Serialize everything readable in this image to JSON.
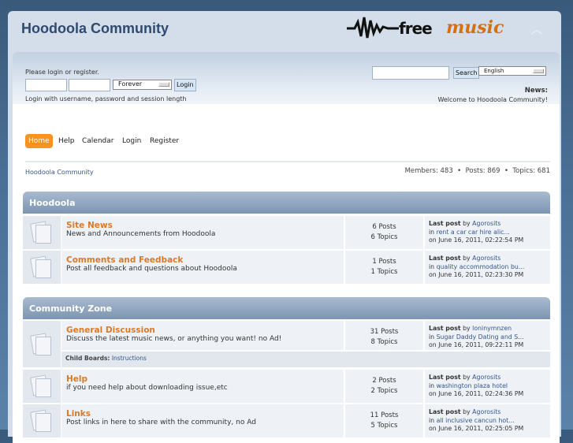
{
  "header": {
    "title": "Hoodoola Community",
    "logo_text_1": "free",
    "logo_text_2": "music",
    "collapse_icon": "chevron-up-icon"
  },
  "login": {
    "prompt": "Please login or register.",
    "session_value": "Forever",
    "login_button": "Login",
    "hint": "Login with username, password and session length"
  },
  "search": {
    "button": "Search",
    "language": "English"
  },
  "news": {
    "label": "News:",
    "text": "Welcome to Hoodoola Community!",
    "text2": "!"
  },
  "nav": [
    "Home",
    "Help",
    "Calendar",
    "Login",
    "Register"
  ],
  "breadcrumb": "Hoodoola Community",
  "stats": "Members: 483  •  Posts: 869  •  Topics: 681",
  "accent": "#f7931e",
  "categories": [
    {
      "name": "Hoodoola",
      "boards": [
        {
          "name": "Site News",
          "desc": "News and Announcements from Hoodoola",
          "posts": "6 Posts",
          "topics": "6 Topics",
          "last_by": "Agorosits",
          "last_in": "rent a car car hire alic...",
          "last_on": "on June 16, 2011, 02:22:54 PM"
        },
        {
          "name": "Comments and Feedback",
          "desc": "Post all feedback and questions about Hoodoola",
          "posts": "1 Posts",
          "topics": "1 Topics",
          "last_by": "Agorosits",
          "last_in": "quality accommodation bu...",
          "last_on": "on June 16, 2011, 02:23:30 PM"
        }
      ]
    },
    {
      "name": "Community Zone",
      "boards": [
        {
          "name": "General Discussion",
          "desc": "Discuss the latest music news, or anything you want! no Ad!",
          "posts": "31 Posts",
          "topics": "8 Topics",
          "last_by": "loninymnzen",
          "last_in": "Sugar Daddy Dating and S...",
          "last_on": "on June 16, 2011, 09:22:11 PM",
          "child_label": "Child Boards:",
          "child": "Instructions"
        },
        {
          "name": "Help",
          "desc": "if you need help about downloading issue,etc",
          "posts": "2 Posts",
          "topics": "2 Topics",
          "last_by": "Agorosits",
          "last_in": "washington plaza hotel",
          "last_on": "on June 16, 2011, 02:24:36 PM"
        },
        {
          "name": "Links",
          "desc": "Post links in here to share with the community, no Ad",
          "posts": "11 Posts",
          "topics": "5 Topics",
          "last_by": "Agorosits",
          "last_in": "all inclusive cancun hot...",
          "last_on": "on June 16, 2011, 02:25:05 PM"
        }
      ]
    }
  ],
  "labels": {
    "last_post_by": "Last post",
    "by": " by ",
    "in": "in "
  }
}
